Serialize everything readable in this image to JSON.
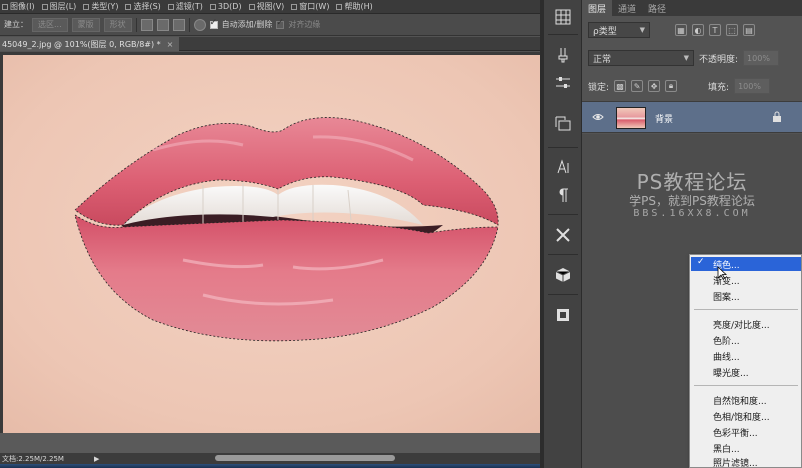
{
  "menu": [
    "图像(I)",
    "图层(L)",
    "类型(Y)",
    "选择(S)",
    "滤镜(T)",
    "3D(D)",
    "视图(V)",
    "窗口(W)",
    "帮助(H)"
  ],
  "options": {
    "new_label": "建立：",
    "selection_btn": "选区...",
    "mask_btn": "蒙版",
    "shape_btn": "形状",
    "auto_add_delete": "自动添加/删除",
    "align_edges": "对齐边缘"
  },
  "document": {
    "tab_title": "45049_2.jpg @ 101%(图层 0, RGB/8#) *",
    "tab_close": "×",
    "status": "文档:2.25M/2.25M",
    "status_arrow": "▶"
  },
  "panel": {
    "tabs": [
      "图层",
      "通道",
      "路径"
    ],
    "filter_kind": "ρ类型",
    "blend_mode": "正常",
    "opacity_label": "不透明度:",
    "opacity_value": "100%",
    "lock_label": "锁定:",
    "fill_label": "填充:",
    "fill_value": "100%",
    "layer_name": "背景"
  },
  "watermark": {
    "title": "PS教程论坛",
    "subtitle": "学PS，就到PS教程论坛",
    "url": "BBS.16XX8.COM"
  },
  "context_menu": {
    "checkmark": "✓",
    "groups": [
      [
        "纯色...",
        "渐变...",
        "图案..."
      ],
      [
        "亮度/对比度...",
        "色阶...",
        "曲线...",
        "曝光度..."
      ],
      [
        "自然饱和度...",
        "色相/饱和度...",
        "色彩平衡...",
        "黑白...",
        "照片滤镜..."
      ]
    ]
  }
}
